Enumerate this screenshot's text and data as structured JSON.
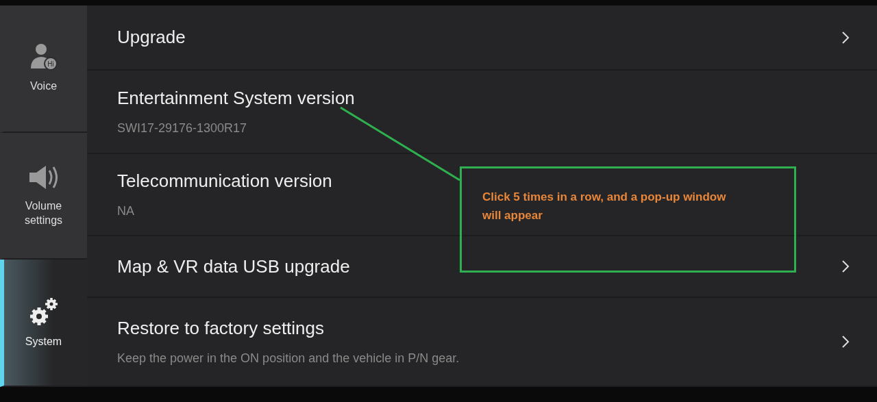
{
  "sidebar": {
    "items": [
      {
        "label": "Voice",
        "kind": "voice",
        "badge": "Hi",
        "selected": false
      },
      {
        "label": "Volume settings",
        "kind": "volume",
        "selected": false
      },
      {
        "label": "System",
        "kind": "system",
        "selected": true
      }
    ]
  },
  "settings": {
    "rows": [
      {
        "title": "Upgrade",
        "chevron": true
      },
      {
        "title": "Entertainment System version",
        "subtitle": "SWI17-29176-1300R17",
        "chevron": false
      },
      {
        "title": "Telecommunication version",
        "subtitle": "NA",
        "chevron": false
      },
      {
        "title": "Map & VR data USB upgrade",
        "chevron": true
      },
      {
        "title": "Restore to factory settings",
        "subtitle": "Keep the power in the ON position and the vehicle in P/N gear.",
        "chevron": true
      }
    ]
  },
  "annotation": {
    "text": "Click 5 times in a row, and a pop-up window will appear"
  }
}
